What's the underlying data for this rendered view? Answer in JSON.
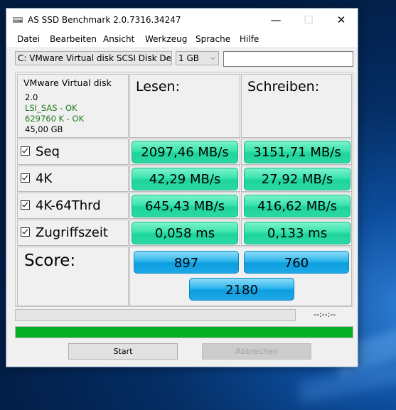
{
  "window": {
    "title": "AS SSD Benchmark 2.0.7316.34247"
  },
  "titlebar_buttons": {
    "minimize": "—",
    "maximize": "☐",
    "close": "✕"
  },
  "menu": [
    "Datei",
    "Bearbeiten",
    "Ansicht",
    "Werkzeug",
    "Sprache",
    "Hilfe"
  ],
  "drive_select": {
    "value": "C: VMware Virtual disk SCSI Disk Device"
  },
  "size_select": {
    "value": "1 GB"
  },
  "text_field": {
    "value": ""
  },
  "drive_info": {
    "name": "VMware Virtual disk",
    "version": "2.0",
    "driver": "LSI_SAS - OK",
    "alignment": "629760 K - OK",
    "capacity": "45,00 GB"
  },
  "headers": {
    "read": "Lesen:",
    "write": "Schreiben:"
  },
  "rows": [
    {
      "label": "Seq",
      "checked": true,
      "read": "2097,46 MB/s",
      "write": "3151,71 MB/s"
    },
    {
      "label": "4K",
      "checked": true,
      "read": "42,29 MB/s",
      "write": "27,92 MB/s"
    },
    {
      "label": "4K-64Thrd",
      "checked": true,
      "read": "645,43 MB/s",
      "write": "416,62 MB/s"
    },
    {
      "label": "Zugriffszeit",
      "checked": true,
      "read": "0,058 ms",
      "write": "0,133 ms"
    }
  ],
  "score": {
    "label": "Score:",
    "read": "897",
    "write": "760",
    "total": "2180"
  },
  "progress": {
    "time": "--:--:--",
    "overall_fraction": 1.0,
    "current_fraction": 0.0
  },
  "buttons": {
    "start": "Start",
    "abort": "Abbrechen"
  },
  "colors": {
    "value_green": "#3ae4ad",
    "score_blue": "#2fb6ec",
    "progress_green": "#06b025"
  }
}
